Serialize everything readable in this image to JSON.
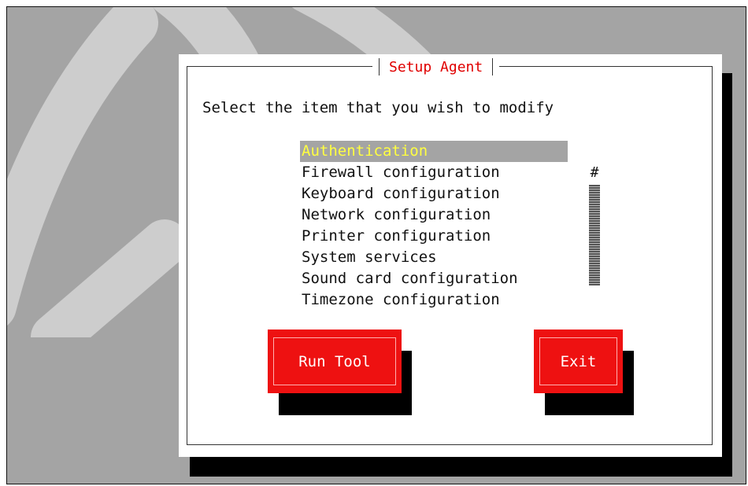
{
  "dialog": {
    "title": "Setup Agent",
    "prompt": "Select the item that you wish to modify"
  },
  "menu": {
    "items": [
      {
        "label": "Authentication",
        "selected": true
      },
      {
        "label": "Firewall configuration",
        "selected": false
      },
      {
        "label": "Keyboard configuration",
        "selected": false
      },
      {
        "label": "Network configuration",
        "selected": false
      },
      {
        "label": "Printer configuration",
        "selected": false
      },
      {
        "label": "System services",
        "selected": false
      },
      {
        "label": "Sound card configuration",
        "selected": false
      },
      {
        "label": "Timezone configuration",
        "selected": false
      }
    ]
  },
  "scrollbar": {
    "thumb_char": "#"
  },
  "buttons": {
    "run_tool": "Run Tool",
    "exit": "Exit"
  },
  "colors": {
    "desktop": "#a4a4a4",
    "title": "#e00000",
    "selected_text": "#ffff40",
    "button": "#ee1111"
  }
}
